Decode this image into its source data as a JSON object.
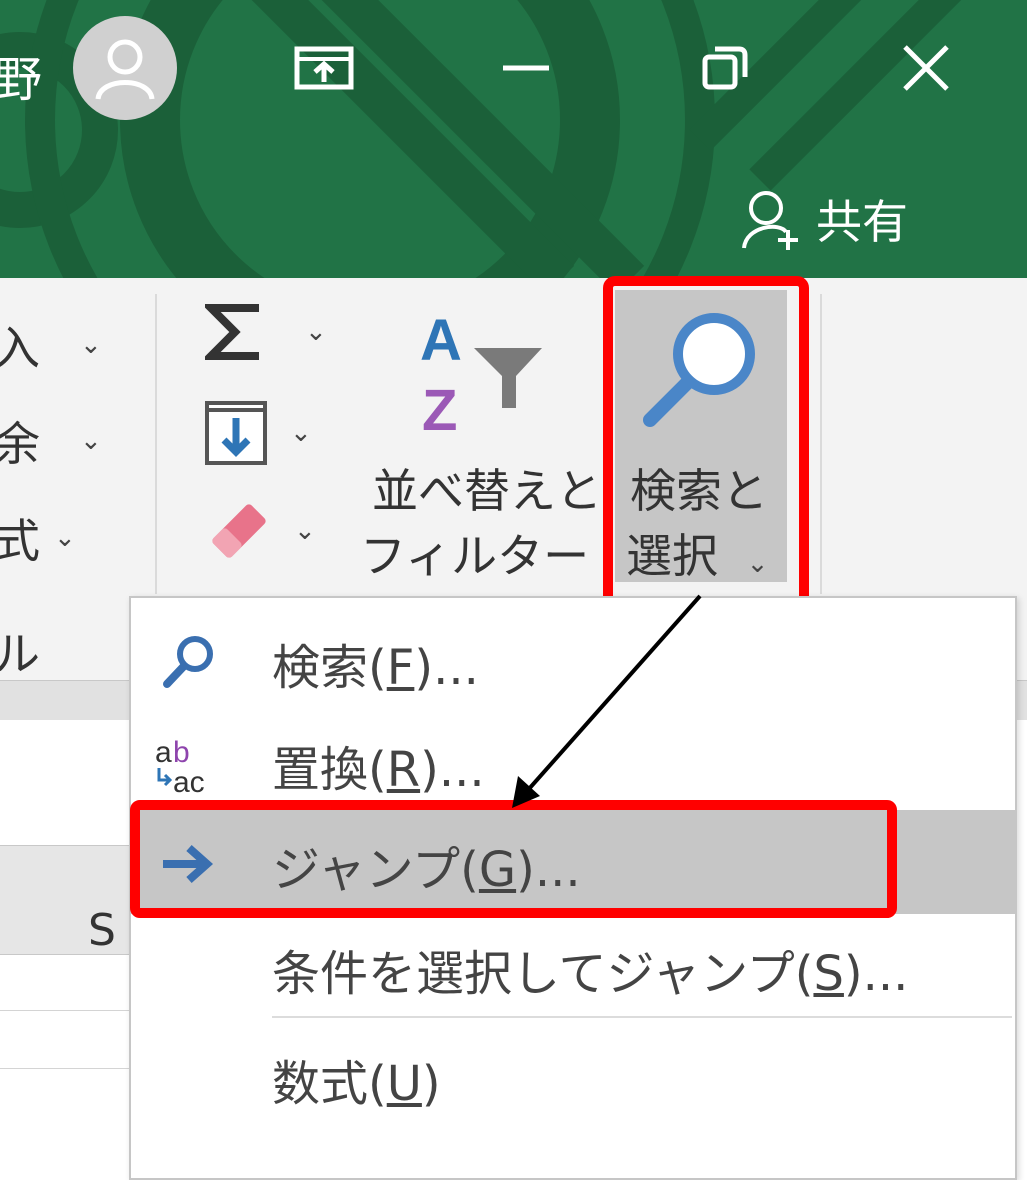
{
  "titlebar": {
    "user_name_partial": "野",
    "share_label": "共有",
    "colors": {
      "background": "#217346",
      "deco": "#1b6039"
    }
  },
  "ribbon": {
    "cells_items": [
      "入",
      "余",
      "式",
      "ル"
    ],
    "sort_filter_label_line1": "並べ替えと",
    "sort_filter_label_line2": "フィルター",
    "find_select_label_line1": "検索と",
    "find_select_label_line2": "選択"
  },
  "sheet": {
    "column_letter": "S"
  },
  "menu": {
    "items": [
      {
        "text": "検索(",
        "key": "F",
        "suffix": ")...",
        "icon": "search-icon"
      },
      {
        "text": "置換(",
        "key": "R",
        "suffix": ")...",
        "icon": "replace-icon"
      },
      {
        "text": "ジャンプ(",
        "key": "G",
        "suffix": ")...",
        "icon": "arrow-right-icon"
      },
      {
        "text": "条件を選択してジャンプ(",
        "key": "S",
        "suffix": ")...",
        "icon": ""
      },
      {
        "text": "数式(",
        "key": "U",
        "suffix": ")",
        "icon": ""
      }
    ]
  },
  "annotation": {
    "highlight_color": "#ff0000"
  }
}
